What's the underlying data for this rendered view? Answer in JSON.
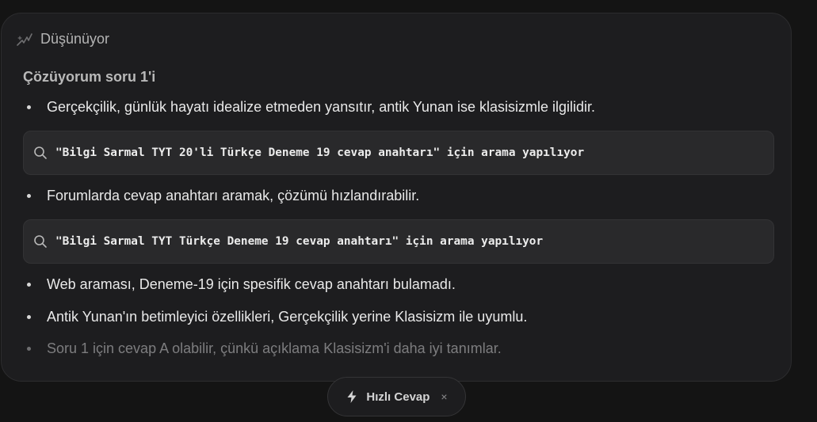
{
  "thinking": {
    "title": "Düşünüyor",
    "section_title": "Çözüyorum soru 1'i",
    "bullets": [
      "Gerçekçilik, günlük hayatı idealize etmeden yansıtır, antik Yunan ise klasisizmle ilgilidir.",
      "Forumlarda cevap anahtarı aramak, çözümü hızlandırabilir.",
      "Web araması, Deneme-19 için spesifik cevap anahtarı bulamadı.",
      "Antik Yunan'ın betimleyici özellikleri, Gerçekçilik yerine Klasisizm ile uyumlu.",
      "Soru 1 için cevap A olabilir, çünkü açıklama Klasisizm'i daha iyi tanımlar."
    ],
    "searches": [
      "\"Bilgi Sarmal TYT 20'li Türkçe Deneme 19 cevap anahtarı\" için arama yapılıyor",
      "\"Bilgi Sarmal TYT Türkçe Deneme 19 cevap anahtarı\" için arama yapılıyor"
    ]
  },
  "mode_chip": {
    "label": "Hızlı Cevap",
    "close": "×"
  },
  "icons": {
    "thinking": "thinking-sparkle-icon",
    "search": "search-icon",
    "bolt": "bolt-icon",
    "close": "close-icon"
  },
  "colors": {
    "background": "#141414",
    "card": "#1d1d1f",
    "search_box": "#29292b",
    "text": "#e9e9e9",
    "muted": "#b4b4b4",
    "faded": "#7d7d7f"
  }
}
